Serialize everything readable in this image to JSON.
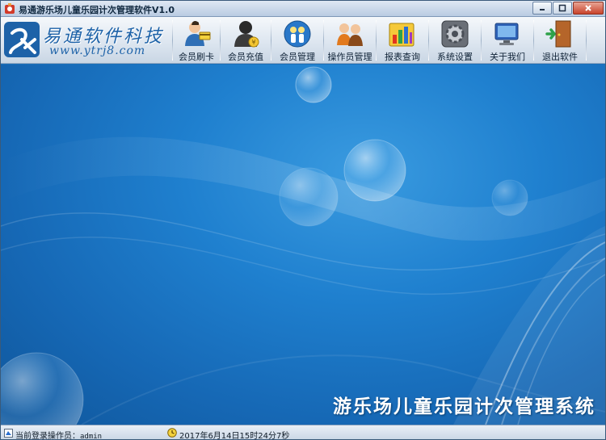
{
  "window": {
    "title": "易通游乐场儿童乐园计次管理软件V1.0"
  },
  "logo": {
    "name": "易通软件科技",
    "url": "www.ytrj8.com"
  },
  "toolbar": {
    "items": [
      {
        "label": "会员刷卡",
        "icon": "member-card-icon"
      },
      {
        "label": "会员充值",
        "icon": "member-recharge-icon"
      },
      {
        "label": "会员管理",
        "icon": "member-manage-icon"
      },
      {
        "label": "操作员管理",
        "icon": "operator-manage-icon"
      },
      {
        "label": "报表查询",
        "icon": "report-query-icon"
      },
      {
        "label": "系统设置",
        "icon": "settings-gear-icon"
      },
      {
        "label": "关于我们",
        "icon": "about-us-icon"
      },
      {
        "label": "退出软件",
        "icon": "exit-door-icon"
      }
    ]
  },
  "main": {
    "banner": "游乐场儿童乐园计次管理系统"
  },
  "status": {
    "operator_label": "当前登录操作员：",
    "operator_value": "admin",
    "datetime": "2017年6月14日15时24分7秒"
  },
  "colors": {
    "background": "#1a6fb8",
    "brand": "#1d62a8"
  }
}
